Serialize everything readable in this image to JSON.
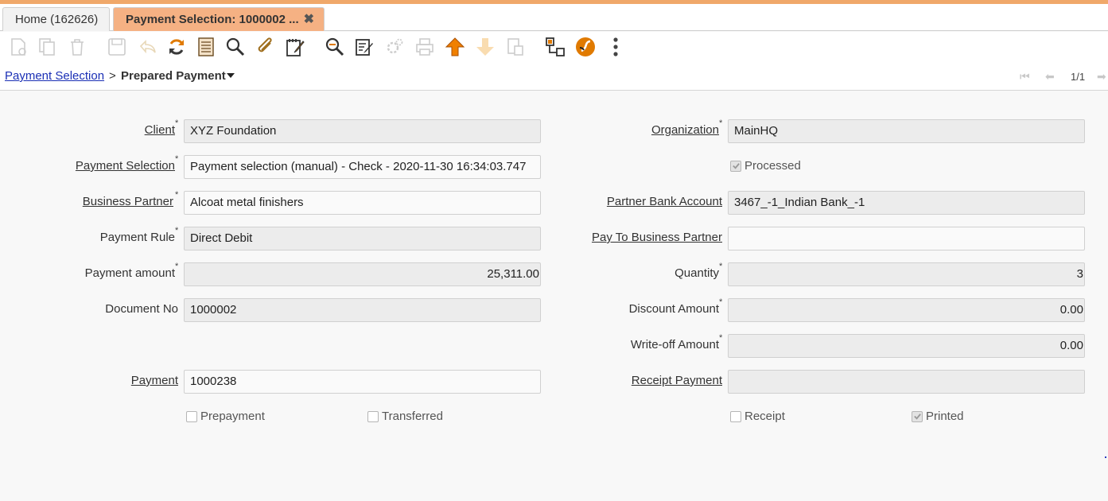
{
  "tabs": {
    "home": "Home (162626)",
    "active": "Payment Selection: 1000002 ...",
    "close_symbol": "✖"
  },
  "toolbar": {
    "icons": [
      "new-icon",
      "copy-icon",
      "delete-icon",
      "save-icon",
      "undo-icon",
      "refresh-icon",
      "grid-toggle-icon",
      "find-icon",
      "attachment-icon",
      "notes-icon",
      "zoom-across-icon",
      "edit-icon",
      "process-icon",
      "print-icon",
      "parent-record-icon",
      "detail-record-icon",
      "archive-icon",
      "workflow-icon",
      "report-icon",
      "more-icon"
    ],
    "accent_color": "#f08000"
  },
  "breadcrumb": {
    "link": "Payment Selection",
    "separator": ">",
    "current": "Prepared Payment",
    "record_count": "1/1"
  },
  "form": {
    "client": {
      "label": "Client",
      "value": "XYZ Foundation"
    },
    "organization": {
      "label": "Organization",
      "value": "MainHQ"
    },
    "payment_selection": {
      "label": "Payment Selection",
      "value": "Payment selection (manual) - Check - 2020-11-30 16:34:03.747"
    },
    "processed": {
      "label": "Processed",
      "checked": true
    },
    "business_partner": {
      "label": "Business Partner ",
      "value": "Alcoat metal finishers"
    },
    "partner_bank_account": {
      "label": "Partner Bank Account",
      "value": "3467_-1_Indian Bank_-1"
    },
    "payment_rule": {
      "label": "Payment Rule",
      "value": "Direct Debit"
    },
    "pay_to_bp": {
      "label": "Pay To Business Partner",
      "value": ""
    },
    "payment_amount": {
      "label": "Payment amount",
      "value": "25,311.00"
    },
    "quantity": {
      "label": "Quantity",
      "value": "3"
    },
    "document_no": {
      "label": "Document No",
      "value": "1000002"
    },
    "discount_amount": {
      "label": "Discount Amount",
      "value": "0.00"
    },
    "writeoff_amount": {
      "label": "Write-off Amount",
      "value": "0.00"
    },
    "payment": {
      "label": "Payment",
      "value": "1000238"
    },
    "receipt_payment": {
      "label": "Receipt Payment",
      "value": ""
    },
    "prepayment": {
      "label": "Prepayment",
      "checked": false
    },
    "transferred": {
      "label": "Transferred",
      "checked": false
    },
    "receipt": {
      "label": "Receipt",
      "checked": false
    },
    "printed": {
      "label": "Printed",
      "checked": true
    }
  },
  "required_marker": "*",
  "nav": {
    "first": "⏮",
    "prev": "⬅",
    "next": "➡"
  }
}
